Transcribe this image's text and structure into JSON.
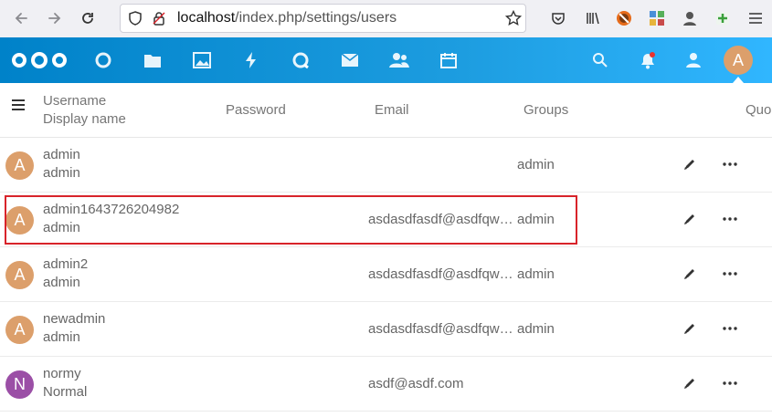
{
  "browser": {
    "url_host": "localhost",
    "url_path": "/index.php/settings/users"
  },
  "header": {
    "user_avatar_letter": "A"
  },
  "table": {
    "columns": {
      "username": "Username",
      "display_name": "Display name",
      "password": "Password",
      "email": "Email",
      "groups": "Groups",
      "quota": "Quo"
    },
    "rows": [
      {
        "avatar": "A",
        "avatar_color": "#dc9f6b",
        "username": "admin",
        "display_name": "admin",
        "email": "",
        "groups": "admin"
      },
      {
        "avatar": "A",
        "avatar_color": "#dc9f6b",
        "username": "admin1643726204982",
        "display_name": "admin",
        "email": "asdasdfasdf@asdfqwer.com",
        "groups": "admin"
      },
      {
        "avatar": "A",
        "avatar_color": "#dc9f6b",
        "username": "admin2",
        "display_name": "admin",
        "email": "asdasdfasdf@asdfqwer.com",
        "groups": "admin"
      },
      {
        "avatar": "A",
        "avatar_color": "#dc9f6b",
        "username": "newadmin",
        "display_name": "admin",
        "email": "asdasdfasdf@asdfqwer.com",
        "groups": "admin"
      },
      {
        "avatar": "N",
        "avatar_color": "#9b4fa6",
        "username": "normy",
        "display_name": "Normal",
        "email": "asdf@asdf.com",
        "groups": ""
      }
    ]
  },
  "colors": {
    "accent": "#0082c9",
    "highlight": "#d8232a"
  }
}
